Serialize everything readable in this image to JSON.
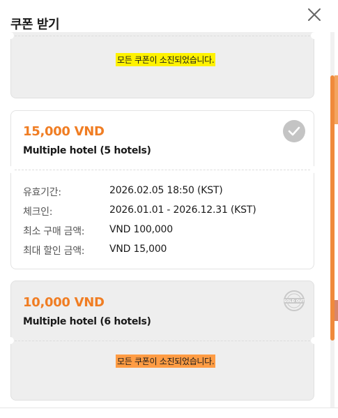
{
  "modal": {
    "title": "쿠폰 받기"
  },
  "coupons": [
    {
      "status": "soldout",
      "message": "모든 쿠폰이 소진되었습니다.",
      "highlight_color": "#fff200"
    },
    {
      "status": "available",
      "price": "15,000 VND",
      "hotel": "Multiple hotel (5 hotels)",
      "details": [
        {
          "label": "유효기간:",
          "value": "2026.02.05 18:50 (KST)"
        },
        {
          "label": "체크인:",
          "value": "2026.01.01 - 2026.12.31 (KST)"
        },
        {
          "label": "최소 구매 금액:",
          "value": "VND 100,000"
        },
        {
          "label": "최대 할인 금액:",
          "value": "VND 15,000"
        }
      ]
    },
    {
      "status": "soldout",
      "price": "10,000 VND",
      "hotel": "Multiple hotel (6 hotels)",
      "badge_text": "SOLD OUT",
      "message": "모든 쿠폰이 소진되었습니다.",
      "highlight_color": "#ff9c44"
    }
  ],
  "colors": {
    "accent": "#f07d23",
    "soldout_bg": "#eeeeee",
    "check_icon_bg": "#c4c4c4"
  }
}
